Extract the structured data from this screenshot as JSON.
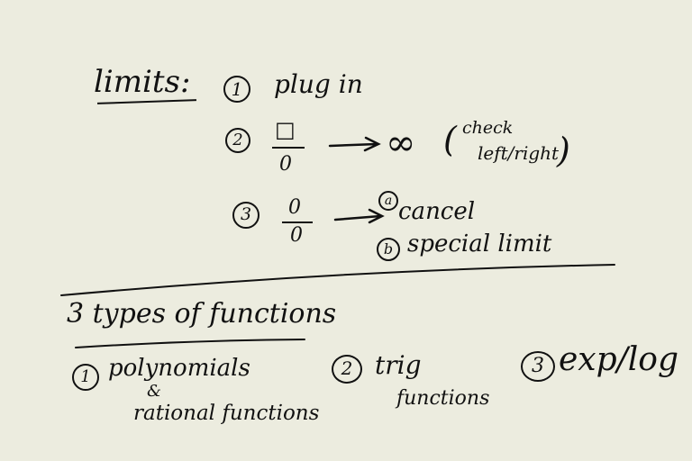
{
  "limits": {
    "heading": "limits:",
    "items": [
      {
        "num": "1",
        "text": "plug in"
      },
      {
        "num": "2",
        "numerator": "□",
        "denominator": "0",
        "result": "∞",
        "note_open": "(",
        "note_line1": "check",
        "note_line2": "left/right",
        "note_close": ")"
      },
      {
        "num": "3",
        "numerator": "0",
        "denominator": "0",
        "options": [
          {
            "letter": "a",
            "text": "cancel"
          },
          {
            "letter": "b",
            "text": "special limit"
          }
        ]
      }
    ]
  },
  "functions": {
    "heading": "3 types of functions",
    "items": [
      {
        "num": "1",
        "line1": "polynomials",
        "line2": "&",
        "line3": "rational functions"
      },
      {
        "num": "2",
        "line1": "trig",
        "line2": "functions"
      },
      {
        "num": "3",
        "line1": "exp/log"
      }
    ]
  }
}
